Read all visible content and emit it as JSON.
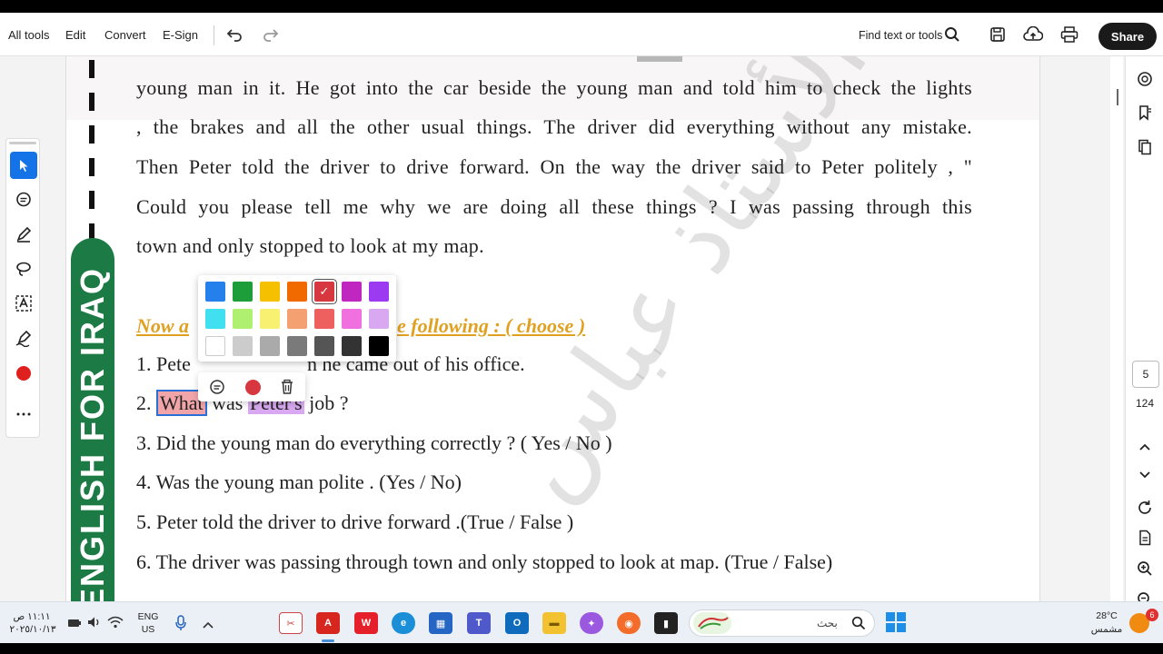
{
  "toolbar": {
    "all_tools": "All tools",
    "edit": "Edit",
    "convert": "Convert",
    "esign": "E-Sign",
    "find": "Find text or tools",
    "share": "Share"
  },
  "document": {
    "paragraph_lines": [
      "young man in it. He got into the car beside the young man and told him to check the lights",
      ", the brakes and all the other usual things. The driver did everything without any mistake.",
      "Then Peter told the driver to drive forward. On the way the driver said to Peter politely , \"",
      "Could you please tell me why we are doing all these things ? I was passing through this",
      "town and only stopped to look at my map."
    ],
    "heading_start": "Now a",
    "heading_end": "e following : ( choose )",
    "q1_start": "1. Pete",
    "q1_end": "n he came out of his office.",
    "q2_num": "2.",
    "q2_word1": "What",
    "q2_mid": "was",
    "q2_word2": "Peter's",
    "q2_end": "job ?",
    "questions": [
      "3. Did the young man do everything correctly ? ( Yes / No )",
      "4. Was the young man polite . (Yes / No)",
      "5. Peter told the driver to drive forward .(True / False )",
      "6. The driver was passing through town and only stopped to look at map. (True / False)"
    ],
    "side_banner": "ENGLISH FOR IRAQ",
    "watermark": "الأستاذ عباس"
  },
  "color_picker": {
    "rows": [
      [
        "#2680eb",
        "#1e9e3a",
        "#f5c000",
        "#f06a00",
        "#d7373f",
        "#c026c0",
        "#9b3af0"
      ],
      [
        "#40e0f0",
        "#b0f070",
        "#f8f070",
        "#f5a070",
        "#ee6060",
        "#f070e0",
        "#d8a8f0"
      ],
      [
        "#ffffff",
        "#cccccc",
        "#aaaaaa",
        "#7a7a7a",
        "#555555",
        "#333333",
        "#000000"
      ]
    ],
    "selected": "#d7373f"
  },
  "right_rail": {
    "page_current": "5",
    "page_total": "124"
  },
  "taskbar": {
    "time": "١١:١١ ص",
    "date": "٢٠٢٥/١٠/١٣",
    "lang_line1": "ENG",
    "lang_line2": "US",
    "search_placeholder": "بحث",
    "temp": "28°C",
    "weather": "مشمس",
    "notif_count": "6"
  }
}
